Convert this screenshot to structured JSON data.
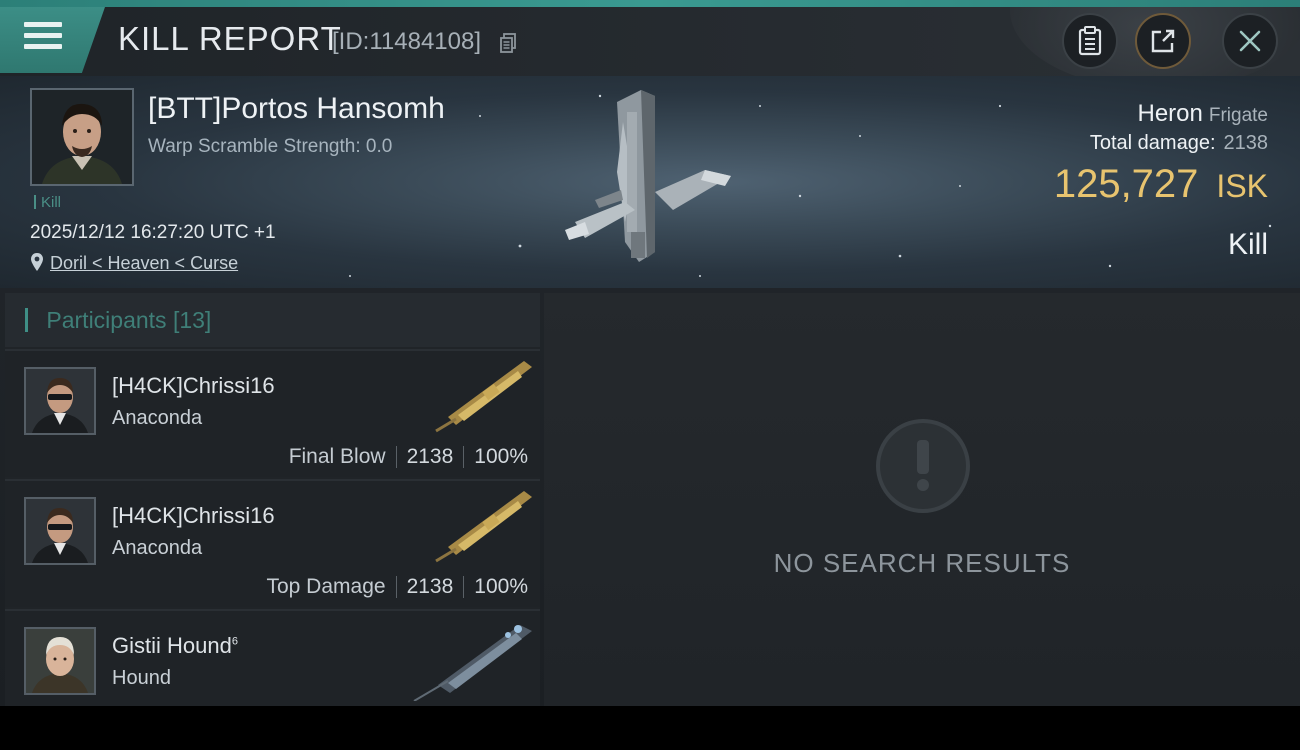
{
  "header": {
    "title": "KILL REPORT",
    "report_id": "[ID:11484108]",
    "icons": [
      "menu-icon",
      "copy-icon",
      "clipboard-icon",
      "share-icon",
      "close-icon"
    ]
  },
  "victim": {
    "name": "[BTT]Portos Hansomh",
    "warp_scramble": "Warp Scramble Strength: 0.0",
    "tag": "Kill",
    "datetime": "2025/12/12 16:27:20 UTC +1",
    "location": "Doril < Heaven < Curse",
    "ship": "Heron",
    "ship_class": "Frigate",
    "total_damage_label": "Total damage:",
    "total_damage": "2138",
    "isk_value": "125,727",
    "isk_unit": "ISK",
    "result": "Kill"
  },
  "participants": {
    "label": "Participants",
    "count": "[13]",
    "rows": [
      {
        "name": "[H4CK]Chrissi16",
        "ship": "Anaconda",
        "tag": "Final Blow",
        "damage": "2138",
        "percent": "100%"
      },
      {
        "name": "[H4CK]Chrissi16",
        "ship": "Anaconda",
        "tag": "Top Damage",
        "damage": "2138",
        "percent": "100%"
      },
      {
        "name": "Gistii Hound",
        "sup": "6",
        "ship": "Hound"
      }
    ]
  },
  "empty_state": {
    "text": "NO SEARCH RESULTS"
  },
  "colors": {
    "accent": "#3a9a91",
    "isk": "#e8c46f"
  }
}
